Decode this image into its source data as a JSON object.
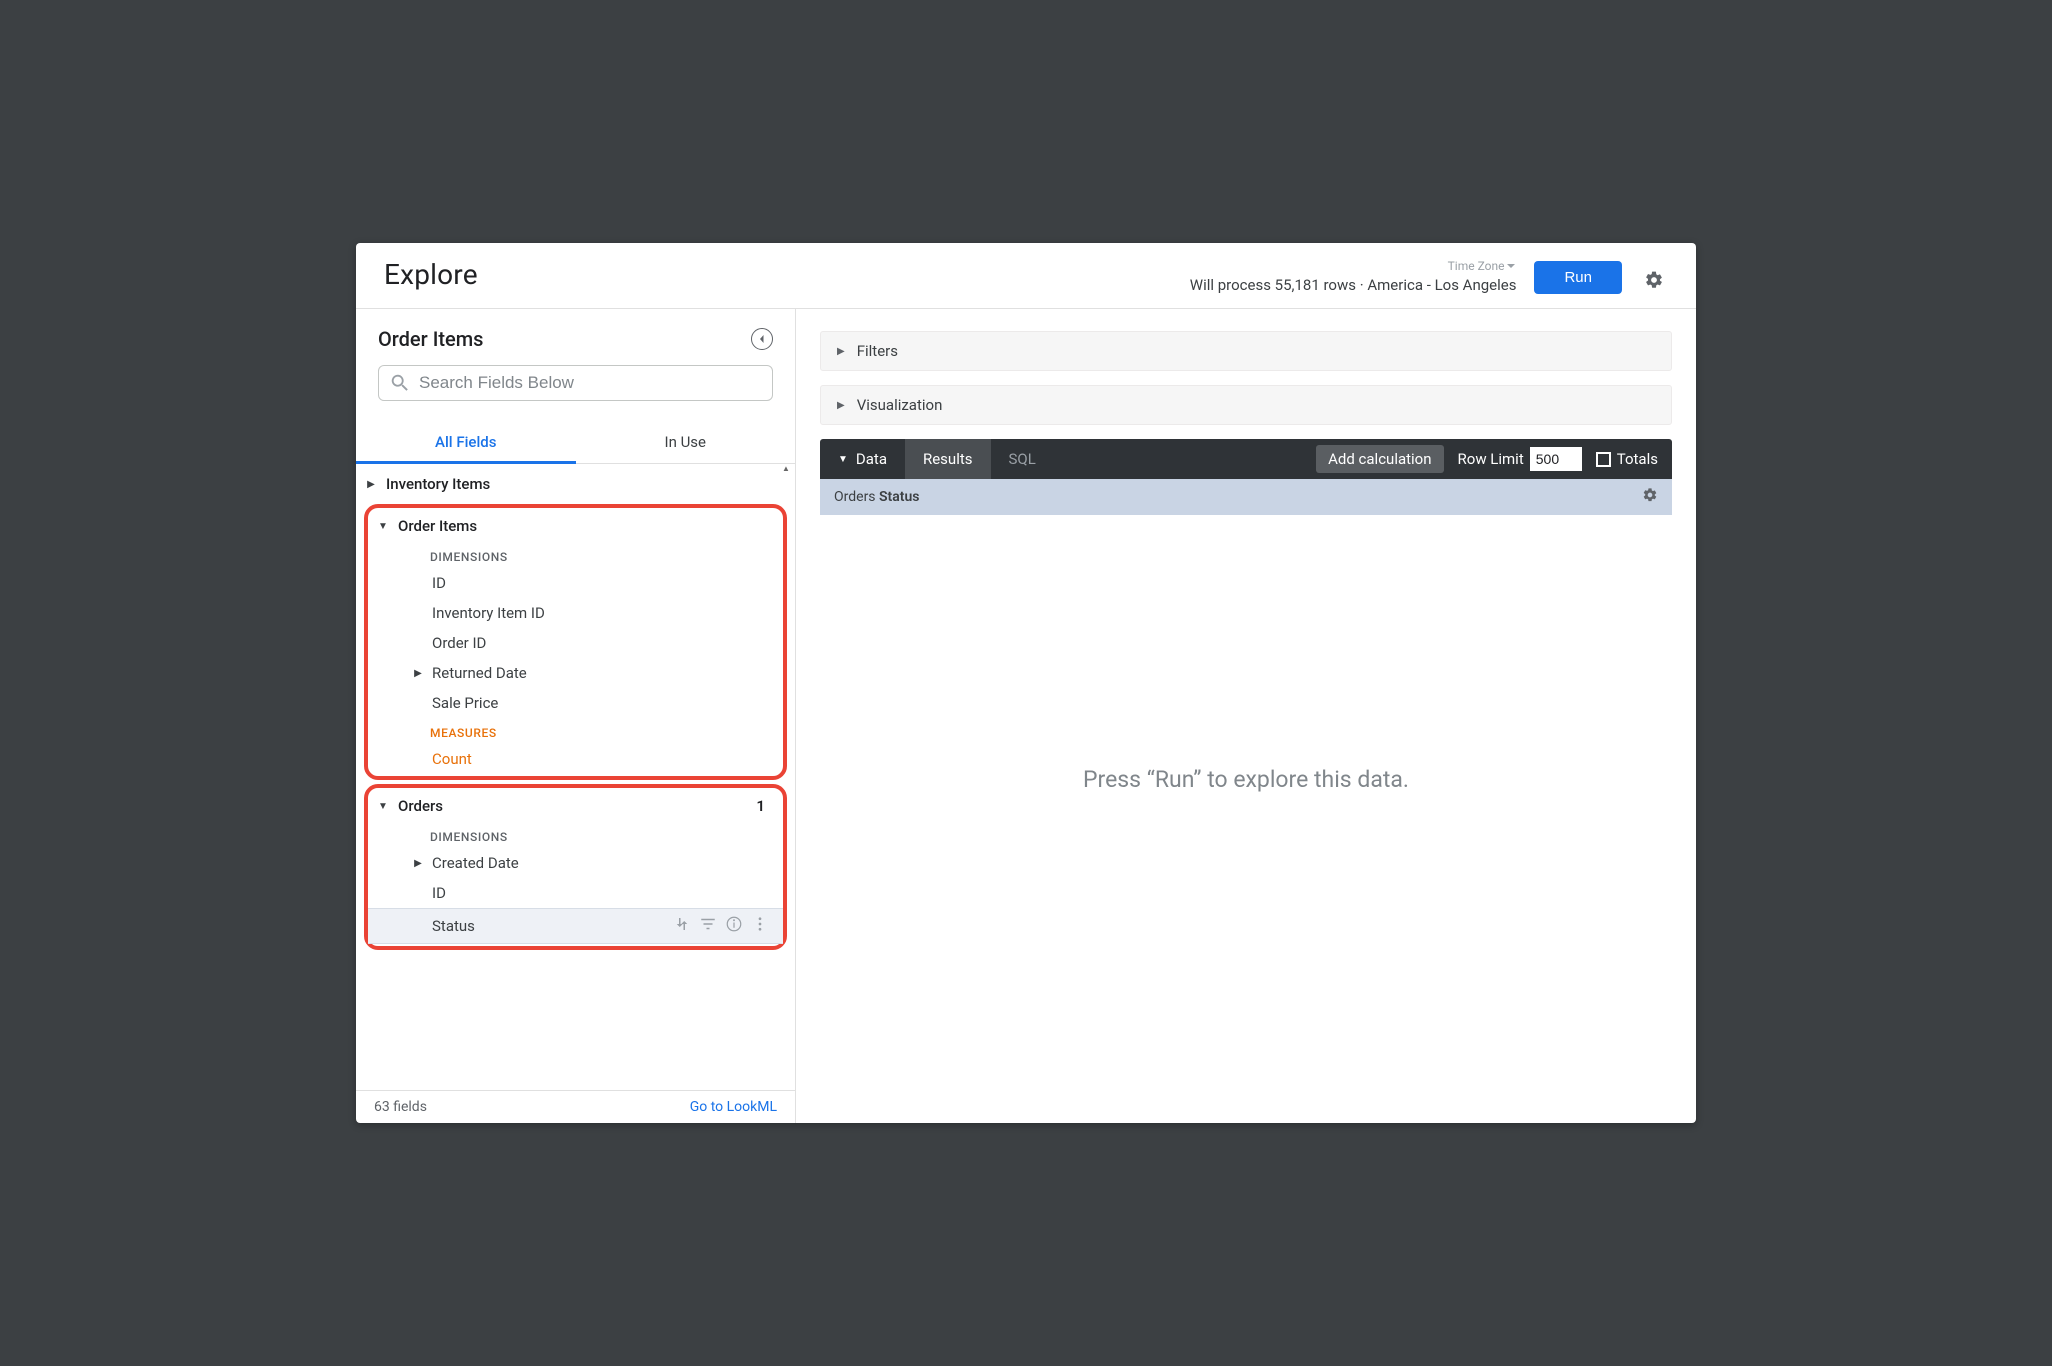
{
  "header": {
    "title": "Explore",
    "timezone_label": "Time Zone",
    "row_info": "Will process 55,181 rows · America - Los Angeles",
    "run_label": "Run"
  },
  "sidebar": {
    "title": "Order Items",
    "search_placeholder": "Search Fields Below",
    "tabs": {
      "all": "All Fields",
      "in_use": "In Use"
    },
    "views": {
      "inventory_items": {
        "label": "Inventory Items"
      },
      "order_items": {
        "label": "Order Items",
        "dimensions_heading": "DIMENSIONS",
        "fields": {
          "id": "ID",
          "inventory_item_id": "Inventory Item ID",
          "order_id": "Order ID",
          "returned_date": "Returned Date",
          "sale_price": "Sale Price"
        },
        "measures_heading": "MEASURES",
        "measures": {
          "count": "Count"
        }
      },
      "orders": {
        "label": "Orders",
        "count": "1",
        "dimensions_heading": "DIMENSIONS",
        "fields": {
          "created_date": "Created Date",
          "id": "ID",
          "status": "Status"
        }
      }
    },
    "footer": {
      "count": "63 fields",
      "link": "Go to LookML"
    }
  },
  "main": {
    "filters_label": "Filters",
    "visualization_label": "Visualization",
    "data_bar": {
      "data": "Data",
      "results": "Results",
      "sql": "SQL",
      "add_calculation": "Add calculation",
      "row_limit_label": "Row Limit",
      "row_limit_value": "500",
      "totals": "Totals"
    },
    "column_header": {
      "view": "Orders ",
      "field": "Status"
    },
    "placeholder": "Press “Run” to explore this data."
  }
}
